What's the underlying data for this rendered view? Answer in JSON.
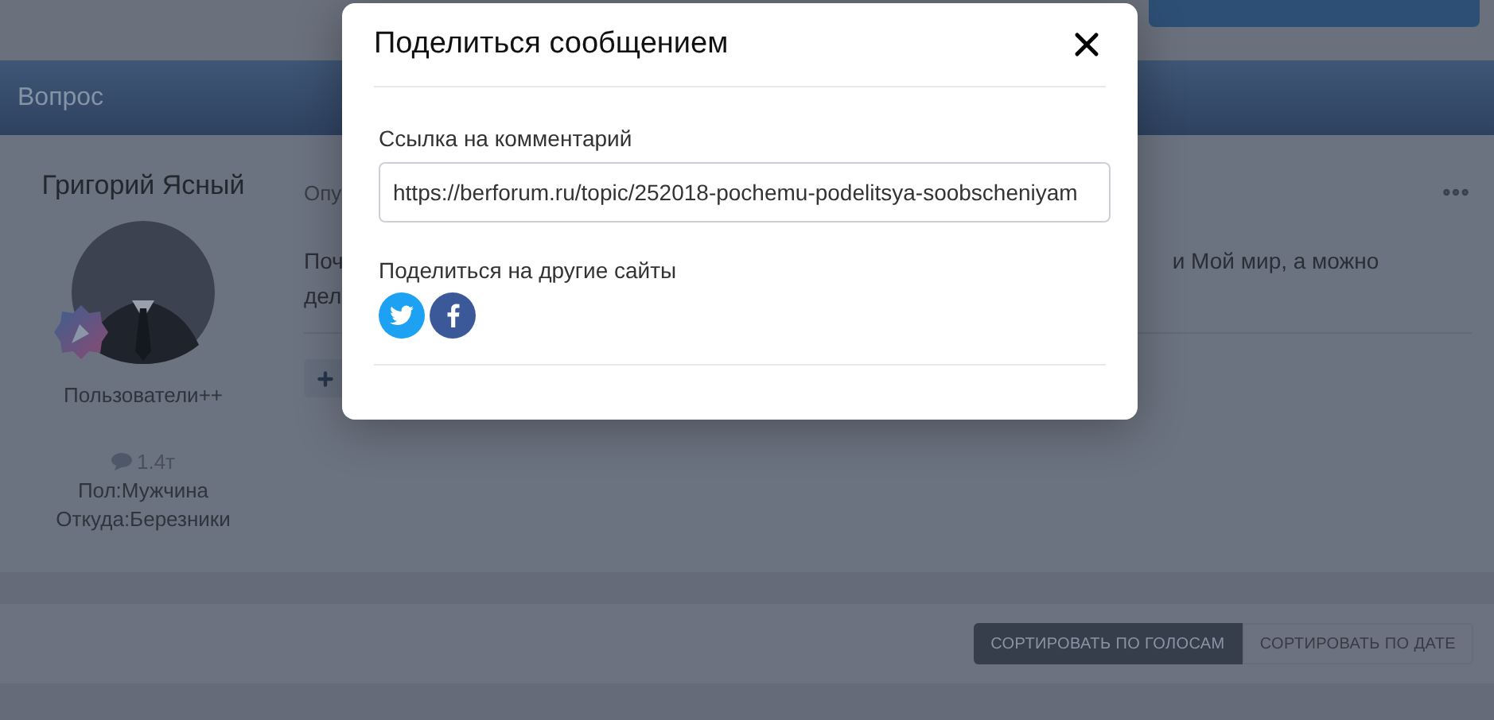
{
  "header": {
    "title": "Вопрос"
  },
  "author": {
    "name": "Григорий Ясный",
    "group": "Пользователи++",
    "messages": "1.4т",
    "gender": "Пол:Мужчина",
    "location": "Откуда:Березники"
  },
  "post": {
    "meta": "Опу",
    "lines": [
      {
        "start": "Поч",
        "end": "и Мой мир, а можно"
      },
      {
        "start": "дел"
      }
    ]
  },
  "share_dialog": {
    "title": "Поделиться сообщением",
    "link_label": "Ссылка на комментарий",
    "link_value": "https://berforum.ru/topic/252018-pochemu-podelitsya-soobscheniyam",
    "share_label": "Поделиться на другие сайты",
    "networks": [
      {
        "kind": "twitter"
      },
      {
        "kind": "facebook"
      }
    ]
  },
  "sort": [
    {
      "label": "СОРТИРОВАТЬ ПО ГОЛОСАМ",
      "selected": true
    },
    {
      "label": "СОРТИРОВАТЬ ПО ДАТЕ",
      "selected": false
    }
  ]
}
